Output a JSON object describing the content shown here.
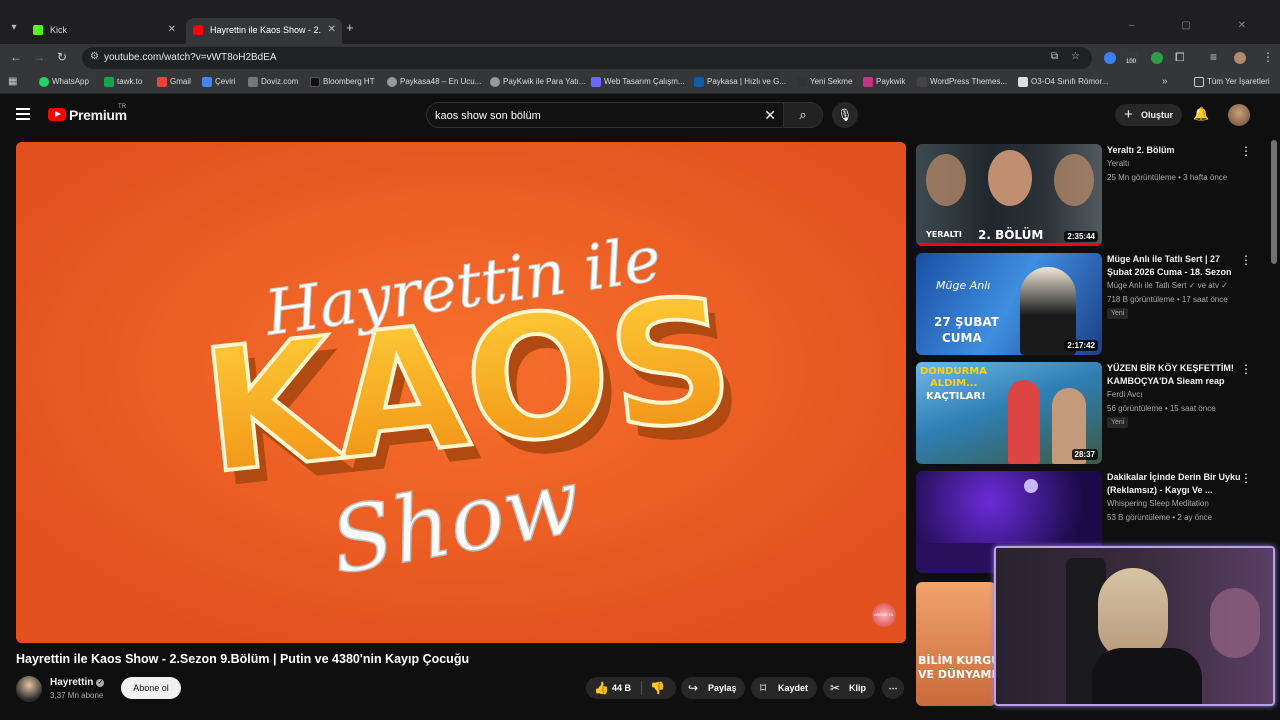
{
  "browser": {
    "tabs": [
      {
        "title": "Kick",
        "favicon_color": "#53fc18"
      },
      {
        "title": "Hayrettin ile Kaos Show - 2.",
        "favicon_color": "#ff0000"
      }
    ],
    "url": "youtube.com/watch?v=vWT8oH2BdEA",
    "ext_badge": "100",
    "bookmarks": [
      "WhatsApp",
      "tawk.to",
      "Gmail",
      "Çeviri",
      "Doviz.com",
      "Bloomberg HT",
      "Paykasa48 – En Ucu...",
      "PayKwik ile Para Yatı...",
      "Web Tasarım Çalışm...",
      "Paykasa | Hızlı ve G...",
      "Yeni Sekme",
      "Paykwik",
      "WordPress Themes...",
      "O3-O4 Sınıfı Römor..."
    ],
    "all_bookmarks": "Tüm Yer İşaretleri"
  },
  "youtube": {
    "logo_text": "Premium",
    "country": "TR",
    "search_query": "kaos show son bölüm",
    "create_label": "Oluştur"
  },
  "video": {
    "thumbnail_lines": [
      "Hayrettin ile",
      "KAOS",
      "Show"
    ],
    "watermark": "ABONE OL",
    "title": "Hayrettin ile Kaos Show - 2.Sezon 9.Bölüm | Putin ve 4380'nin Kayıp Çocuğu",
    "channel": "Hayrettin",
    "subscribers": "3,37 Mn abone",
    "subscribe_label": "Abone ol",
    "likes": "44 B",
    "share_label": "Paylaş",
    "save_label": "Kaydet",
    "clip_label": "Klip"
  },
  "recommendations": [
    {
      "title": "Yeraltı 2. Bölüm",
      "channel": "Yeraltı",
      "meta": "25 Mn görüntüleme • 3 hafta önce",
      "duration": "2:35:44",
      "badge": "",
      "thumb_text": [
        "YERALTI",
        "2. BÖLÜM"
      ]
    },
    {
      "title": "Müge Anlı ile Tatlı Sert | 27 Şubat 2026 Cuma - 18. Sezon",
      "channel": "Müge Anlı ile Tatlı Sert ✓ ve atv ✓",
      "meta": "718 B görüntüleme • 17 saat önce",
      "duration": "2:17:42",
      "badge": "Yeni",
      "thumb_text": [
        "Müge Anlı",
        "27 ŞUBAT",
        "CUMA"
      ]
    },
    {
      "title": "YÜZEN BİR KÖY KEŞFETTİM! KAMBOÇYA'DA Sieam reap",
      "channel": "Ferdi Avcı",
      "meta": "56 görüntüleme • 15 saat önce",
      "duration": "28:37",
      "badge": "Yeni",
      "thumb_text": [
        "DONDURMA",
        "ALDIM...",
        "KAÇTILAR!"
      ]
    },
    {
      "title": "Dakikalar İçinde Derin Bir Uyku (Reklamsız) - Kaygı Ve ...",
      "channel": "Whispering Sleep Meditation",
      "meta": "53 B görüntüleme • 2 ay önce",
      "duration": "",
      "badge": "",
      "thumb_text": []
    },
    {
      "title": "",
      "channel": "",
      "meta": "",
      "duration": "",
      "badge": "",
      "thumb_text": [
        "BİLİM KURGU",
        "VE DÜNYAMI"
      ]
    }
  ],
  "colors": {
    "accent": "#ff0000",
    "thumb_bg": "#ec5a23",
    "webcam_border": "#b9a2e8"
  }
}
